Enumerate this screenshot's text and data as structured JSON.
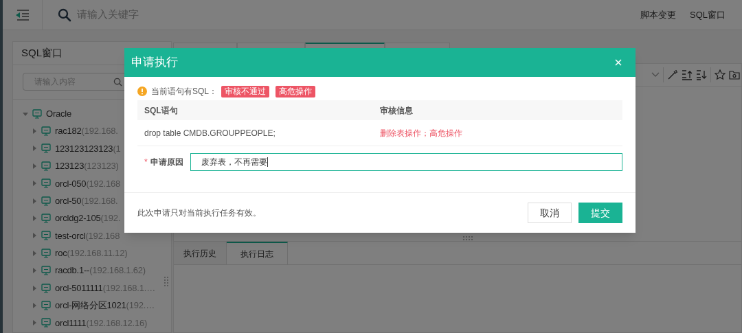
{
  "topbar": {
    "search_placeholder": "请输入关键字",
    "nav": [
      "脚本变更",
      "SQL窗口"
    ]
  },
  "sidebar": {
    "title": "SQL窗口",
    "search_placeholder": "请输入内容",
    "tree": [
      {
        "name": "Oracle",
        "expanded": true,
        "children": [
          {
            "name": "rac182",
            "address": "(192.168.",
            "expanded": false
          },
          {
            "name": "123123123123",
            "address": "(1",
            "expanded": false
          },
          {
            "name": "123123",
            "address": "(123123)",
            "expanded": false
          },
          {
            "name": "orcl-050",
            "address": "(192.168",
            "expanded": false
          },
          {
            "name": "orcl-50",
            "address": "(192.168.",
            "expanded": false
          },
          {
            "name": "orcldg2-105",
            "address": "(192.",
            "expanded": false
          },
          {
            "name": "test-orcl",
            "address": "(192.168",
            "expanded": false
          },
          {
            "name": "roc",
            "address": "(192.168.11.12)",
            "expanded": false
          },
          {
            "name": "racdb.1--",
            "address": "(192.168.1.62)",
            "expanded": false
          },
          {
            "name": "orcl-5011111",
            "address": "(192.168.1.…",
            "expanded": false
          },
          {
            "name": "orcl-网络分区1021",
            "address": "(192.…",
            "expanded": false
          },
          {
            "name": "orcl1111",
            "address": "(192.168.12.16)",
            "expanded": false
          }
        ]
      }
    ]
  },
  "editor_tabs": [
    {
      "selected": false
    },
    {
      "selected": false
    },
    {
      "selected": true
    },
    {
      "selected": false
    }
  ],
  "bottom_tabs": [
    {
      "label": "执行历史",
      "selected": false
    },
    {
      "label": "执行日志",
      "selected": true
    }
  ],
  "dialog": {
    "title": "申请执行",
    "warning": "当前语句有SQL：",
    "tags": [
      "审核不通过",
      "高危操作"
    ],
    "columns": [
      "SQL语句",
      "审核信息"
    ],
    "rows": [
      {
        "sql": "drop table CMDB.GROUPPEOPLE;",
        "audit": "删除表操作；高危操作"
      }
    ],
    "reason_label": "申请原因",
    "required_mark": "*",
    "reason_value": "废弃表，不再需要",
    "note": "此次申请只对当前执行任务有效。",
    "buttons": [
      {
        "label": "取消",
        "kind": "secondary"
      },
      {
        "label": "提交",
        "kind": "primary"
      }
    ]
  }
}
